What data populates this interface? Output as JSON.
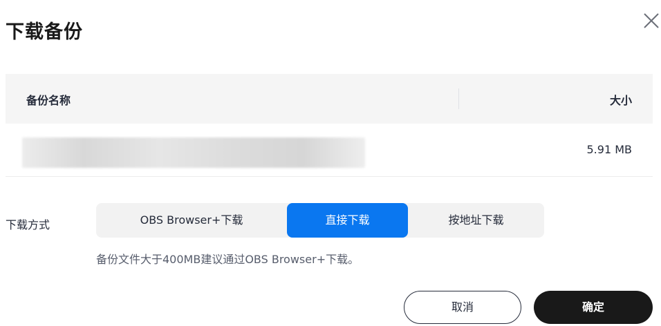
{
  "dialog": {
    "title": "下载备份"
  },
  "table": {
    "columns": {
      "name": "备份名称",
      "size": "大小"
    },
    "rows": [
      {
        "size": "5.91 MB"
      }
    ]
  },
  "download_method": {
    "label": "下载方式",
    "options": [
      "OBS Browser+下载",
      "直接下载",
      "按地址下载"
    ],
    "selected": "直接下载",
    "hint": "备份文件大于400MB建议通过OBS Browser+下载。"
  },
  "footer": {
    "cancel_label": "取消",
    "confirm_label": "确定"
  },
  "colors": {
    "accent": "#0a77f0",
    "primary_button": "#191919"
  },
  "icons": {
    "close": "close-icon"
  }
}
